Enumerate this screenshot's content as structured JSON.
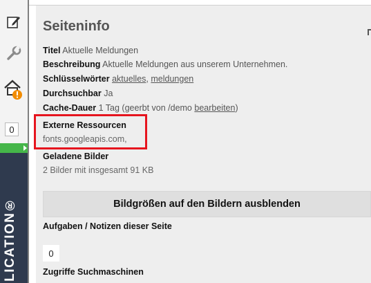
{
  "rail": {
    "count": "0",
    "vertical_text": "LICATION®",
    "icons": [
      "edit-icon",
      "wrench-icon",
      "home-warning-icon"
    ]
  },
  "panel": {
    "title": "Seiteninfo",
    "meta": {
      "titel_label": "Titel",
      "titel_value": "Aktuelle Meldungen",
      "beschreibung_label": "Beschreibung",
      "beschreibung_value": "Aktuelle Meldungen aus unserem Unternehmen.",
      "schluessel_label": "Schlüsselwörter",
      "keyword_1": "aktuelles",
      "keyword_sep": ",",
      "keyword_2": "meldungen",
      "durchsuchbar_label": "Durchsuchbar",
      "durchsuchbar_value": "Ja",
      "cache_label": "Cache-Dauer",
      "cache_value": "1 Tag (geerbt von /demo",
      "cache_link": "bearbeiten",
      "cache_close": ")"
    },
    "externe": {
      "heading": "Externe Ressourcen",
      "value": "fonts.googleapis.com,"
    },
    "bilder": {
      "heading": "Geladene Bilder",
      "value": "2 Bilder mit insgesamt 91 KB"
    },
    "toggle_button": "Bildgrößen auf den Bildern ausblenden",
    "notes": {
      "heading": "Aufgaben / Notizen dieser Seite",
      "count": "0"
    },
    "search": {
      "heading": "Zugriffe Suchmaschinen"
    }
  },
  "colors": {
    "highlight": "#e6141e",
    "rail_green": "#45b649",
    "rail_navy": "#2f3a4e"
  }
}
